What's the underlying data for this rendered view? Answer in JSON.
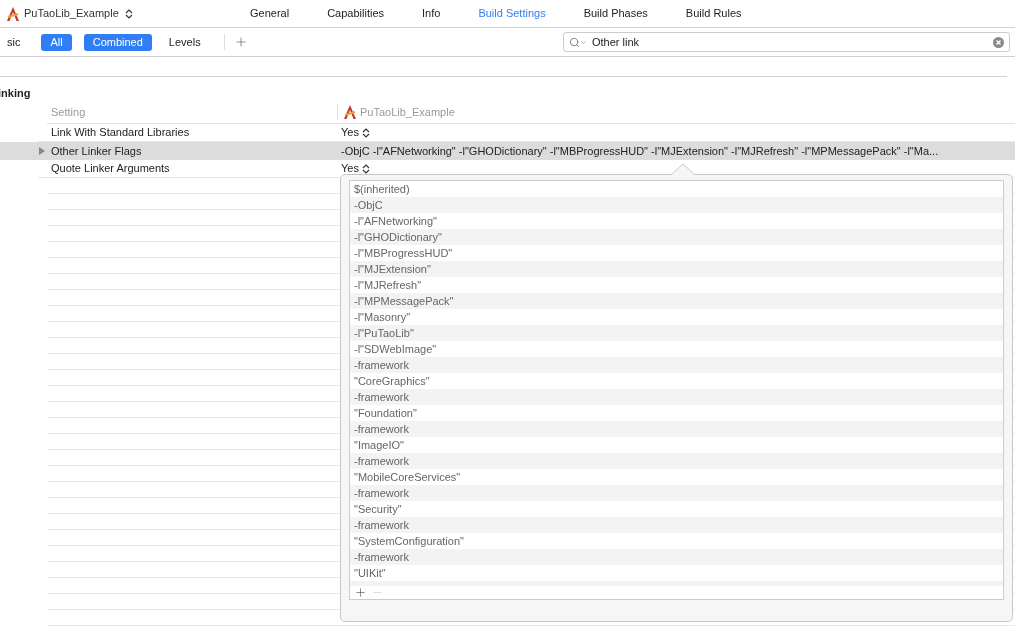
{
  "project": {
    "name": "PuTaoLib_Example"
  },
  "tabs": [
    {
      "label": "General",
      "selected": false
    },
    {
      "label": "Capabilities",
      "selected": false
    },
    {
      "label": "Info",
      "selected": false
    },
    {
      "label": "Build Settings",
      "selected": true
    },
    {
      "label": "Build Phases",
      "selected": false
    },
    {
      "label": "Build Rules",
      "selected": false
    }
  ],
  "filters": [
    {
      "label": "sic",
      "selected": false
    },
    {
      "label": "All",
      "selected": true
    }
  ],
  "views": [
    {
      "label": "Combined",
      "selected": true
    },
    {
      "label": "Levels",
      "selected": false
    }
  ],
  "search": {
    "value": "Other link"
  },
  "section": {
    "title": "inking"
  },
  "table": {
    "columns": [
      "Setting",
      "PuTaoLib_Example"
    ],
    "rows": [
      {
        "name": "Link With Standard Libraries",
        "value": "Yes",
        "kind": "popup",
        "expandable": false,
        "selected": false
      },
      {
        "name": "Other Linker Flags",
        "value": "-ObjC -l\"AFNetworking\" -l\"GHODictionary\" -l\"MBProgressHUD\" -l\"MJExtension\" -l\"MJRefresh\" -l\"MPMessagePack\" -l\"Ma...",
        "kind": "text",
        "expandable": true,
        "selected": true
      },
      {
        "name": "Quote Linker Arguments",
        "value": "Yes",
        "kind": "popup",
        "expandable": false,
        "selected": false
      }
    ]
  },
  "popover": {
    "items": [
      "$(inherited)",
      "-ObjC",
      "-l\"AFNetworking\"",
      "-l\"GHODictionary\"",
      "-l\"MBProgressHUD\"",
      "-l\"MJExtension\"",
      "-l\"MJRefresh\"",
      "-l\"MPMessagePack\"",
      "-l\"Masonry\"",
      "-l\"PuTaoLib\"",
      "-l\"SDWebImage\"",
      "-framework",
      "\"CoreGraphics\"",
      "-framework",
      "\"Foundation\"",
      "-framework",
      "\"ImageIO\"",
      "-framework",
      "\"MobileCoreServices\"",
      "-framework",
      "\"Security\"",
      "-framework",
      "\"SystemConfiguration\"",
      "-framework",
      "\"UIKit\""
    ],
    "remove_disabled": true
  }
}
